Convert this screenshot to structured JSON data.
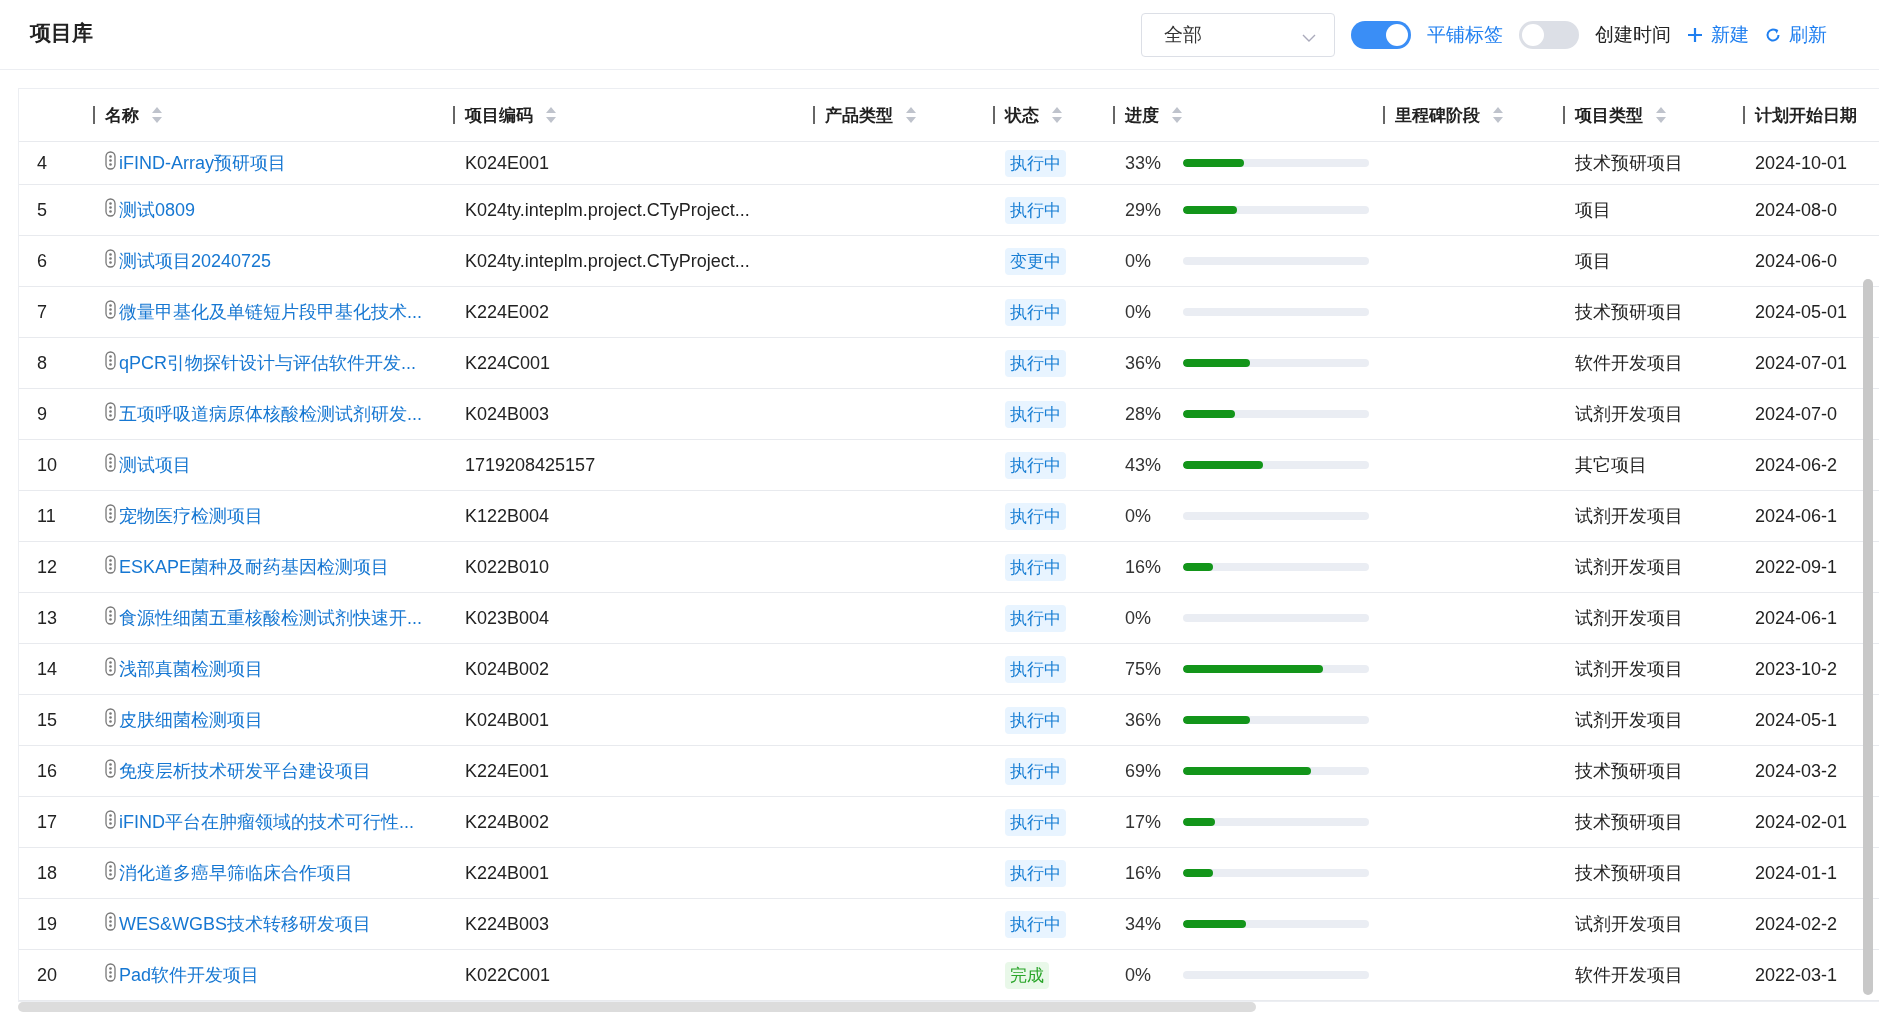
{
  "title": "项目库",
  "filter": {
    "value": "全部"
  },
  "toggles": [
    {
      "label": "平铺标签",
      "on": true
    },
    {
      "label": "创建时间",
      "on": false
    }
  ],
  "actions": [
    {
      "label": "新建",
      "kind": "add"
    },
    {
      "label": "刷新",
      "kind": "refresh"
    }
  ],
  "table": {
    "columns": [
      {
        "kind": "index",
        "sortable": false
      },
      {
        "label": "名称",
        "kind": "name",
        "sortable": true
      },
      {
        "label": "项目编码",
        "kind": "code",
        "sortable": true
      },
      {
        "label": "产品类型",
        "kind": "product",
        "sortable": true
      },
      {
        "label": "状态",
        "kind": "status",
        "sortable": true
      },
      {
        "label": "进度",
        "kind": "progress",
        "sortable": true
      },
      {
        "label": "里程碑阶段",
        "kind": "milestone",
        "sortable": true
      },
      {
        "label": "项目类型",
        "kind": "type",
        "sortable": true
      },
      {
        "label": "计划开始日期",
        "kind": "date",
        "sortable": false
      }
    ],
    "rows": [
      {
        "index": "4",
        "name": "iFIND-Array预研项目",
        "code": "K024E001",
        "status": "执行中",
        "kind": "active",
        "progress": "33%",
        "level": 0.33,
        "project_type": "技术预研项目",
        "start": "2024-10-01"
      },
      {
        "index": "5",
        "name": "测试0809",
        "code": "K024ty.inteplm.project.CTyProject...",
        "status": "执行中",
        "kind": "active",
        "progress": "29%",
        "level": 0.29,
        "project_type": "项目",
        "start": "2024-08-0"
      },
      {
        "index": "6",
        "name": "测试项目20240725",
        "code": "K024ty.inteplm.project.CTyProject...",
        "status": "变更中",
        "kind": "active",
        "progress": "0%",
        "level": 0,
        "project_type": "项目",
        "start": "2024-06-0"
      },
      {
        "index": "7",
        "name": "微量甲基化及单链短片段甲基化技术...",
        "code": "K224E002",
        "status": "执行中",
        "kind": "active",
        "progress": "0%",
        "level": 0,
        "project_type": "技术预研项目",
        "start": "2024-05-01"
      },
      {
        "index": "8",
        "name": "qPCR引物探针设计与评估软件开发...",
        "code": "K224C001",
        "status": "执行中",
        "kind": "active",
        "progress": "36%",
        "level": 0.36,
        "project_type": "软件开发项目",
        "start": "2024-07-01"
      },
      {
        "index": "9",
        "name": "五项呼吸道病原体核酸检测试剂研发...",
        "code": "K024B003",
        "status": "执行中",
        "kind": "active",
        "progress": "28%",
        "level": 0.28,
        "project_type": "试剂开发项目",
        "start": "2024-07-0"
      },
      {
        "index": "10",
        "name": "测试项目",
        "code": "1719208425157",
        "status": "执行中",
        "kind": "active",
        "progress": "43%",
        "level": 0.43,
        "project_type": "其它项目",
        "start": "2024-06-2"
      },
      {
        "index": "11",
        "name": "宠物医疗检测项目",
        "code": "K122B004",
        "status": "执行中",
        "kind": "active",
        "progress": "0%",
        "level": 0,
        "project_type": "试剂开发项目",
        "start": "2024-06-1"
      },
      {
        "index": "12",
        "name": "ESKAPE菌种及耐药基因检测项目",
        "code": "K022B010",
        "status": "执行中",
        "kind": "active",
        "progress": "16%",
        "level": 0.16,
        "project_type": "试剂开发项目",
        "start": "2022-09-1"
      },
      {
        "index": "13",
        "name": "食源性细菌五重核酸检测试剂快速开...",
        "code": "K023B004",
        "status": "执行中",
        "kind": "active",
        "progress": "0%",
        "level": 0,
        "project_type": "试剂开发项目",
        "start": "2024-06-1"
      },
      {
        "index": "14",
        "name": "浅部真菌检测项目",
        "code": "K024B002",
        "status": "执行中",
        "kind": "active",
        "progress": "75%",
        "level": 0.75,
        "project_type": "试剂开发项目",
        "start": "2023-10-2"
      },
      {
        "index": "15",
        "name": "皮肤细菌检测项目",
        "code": "K024B001",
        "status": "执行中",
        "kind": "active",
        "progress": "36%",
        "level": 0.36,
        "project_type": "试剂开发项目",
        "start": "2024-05-1"
      },
      {
        "index": "16",
        "name": "免疫层析技术研发平台建设项目",
        "code": "K224E001",
        "status": "执行中",
        "kind": "active",
        "progress": "69%",
        "level": 0.69,
        "project_type": "技术预研项目",
        "start": "2024-03-2"
      },
      {
        "index": "17",
        "name": "iFIND平台在肿瘤领域的技术可行性...",
        "code": "K224B002",
        "status": "执行中",
        "kind": "active",
        "progress": "17%",
        "level": 0.17,
        "project_type": "技术预研项目",
        "start": "2024-02-01"
      },
      {
        "index": "18",
        "name": "消化道多癌早筛临床合作项目",
        "code": "K224B001",
        "status": "执行中",
        "kind": "active",
        "progress": "16%",
        "level": 0.16,
        "project_type": "技术预研项目",
        "start": "2024-01-1"
      },
      {
        "index": "19",
        "name": "WES&WGBS技术转移研发项目",
        "code": "K224B003",
        "status": "执行中",
        "kind": "active",
        "progress": "34%",
        "level": 0.34,
        "project_type": "试剂开发项目",
        "start": "2024-02-2"
      },
      {
        "index": "20",
        "name": "Pad软件开发项目",
        "code": "K022C001",
        "status": "完成",
        "kind": "done",
        "progress": "0%",
        "level": 0,
        "project_type": "软件开发项目",
        "start": "2022-03-1"
      }
    ]
  }
}
